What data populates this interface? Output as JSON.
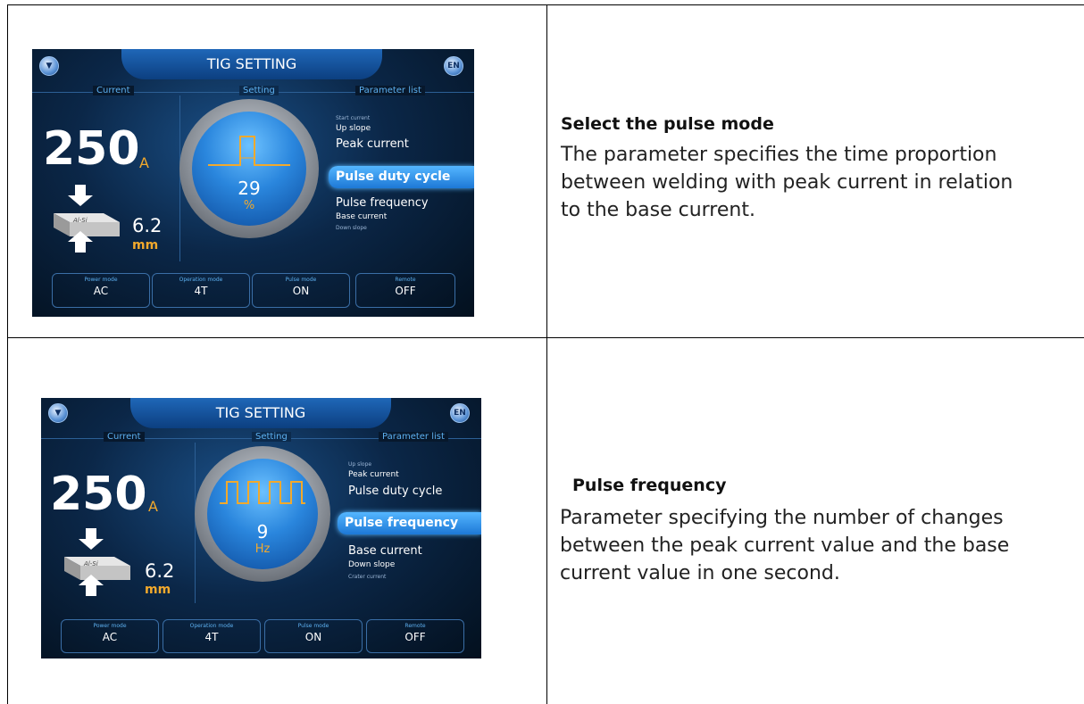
{
  "rows": [
    {
      "title": "Select the pulse mode",
      "description_lines": [
        "The parameter specifies the time proportion",
        "between welding with peak current in relation",
        "to the base current."
      ],
      "screen": {
        "title": "TIG SETTING",
        "lang_button": "EN",
        "sections": {
          "current": "Current",
          "setting": "Setting",
          "parameter_list": "Parameter list"
        },
        "current_value": "250",
        "current_unit": "A",
        "material": "Al-Si",
        "thickness": "6.2",
        "thickness_unit": "mm",
        "dial_value": "29",
        "dial_unit": "%",
        "params": [
          "Start current",
          "Up slope",
          "Peak current",
          "Pulse duty cycle",
          "Pulse frequency",
          "Base current",
          "Down slope"
        ],
        "modes": [
          {
            "label": "Power mode",
            "value": "AC"
          },
          {
            "label": "Operation mode",
            "value": "4T"
          },
          {
            "label": "Pulse mode",
            "value": "ON"
          },
          {
            "label": "Remote",
            "value": "OFF"
          }
        ]
      }
    },
    {
      "title": "Pulse frequency",
      "description_lines": [
        "Parameter specifying the number of changes",
        "between the peak current value and the base",
        "current value in one second."
      ],
      "screen": {
        "title": "TIG SETTING",
        "lang_button": "EN",
        "sections": {
          "current": "Current",
          "setting": "Setting",
          "parameter_list": "Parameter list"
        },
        "current_value": "250",
        "current_unit": "A",
        "material": "Al-Si",
        "thickness": "6.2",
        "thickness_unit": "mm",
        "dial_value": "9",
        "dial_unit": "Hz",
        "params": [
          "Up slope",
          "Peak current",
          "Pulse duty cycle",
          "Pulse frequency",
          "Base current",
          "Down slope",
          "Crater current"
        ],
        "modes": [
          {
            "label": "Power mode",
            "value": "AC"
          },
          {
            "label": "Operation mode",
            "value": "4T"
          },
          {
            "label": "Pulse mode",
            "value": "ON"
          },
          {
            "label": "Remote",
            "value": "OFF"
          }
        ]
      }
    }
  ]
}
